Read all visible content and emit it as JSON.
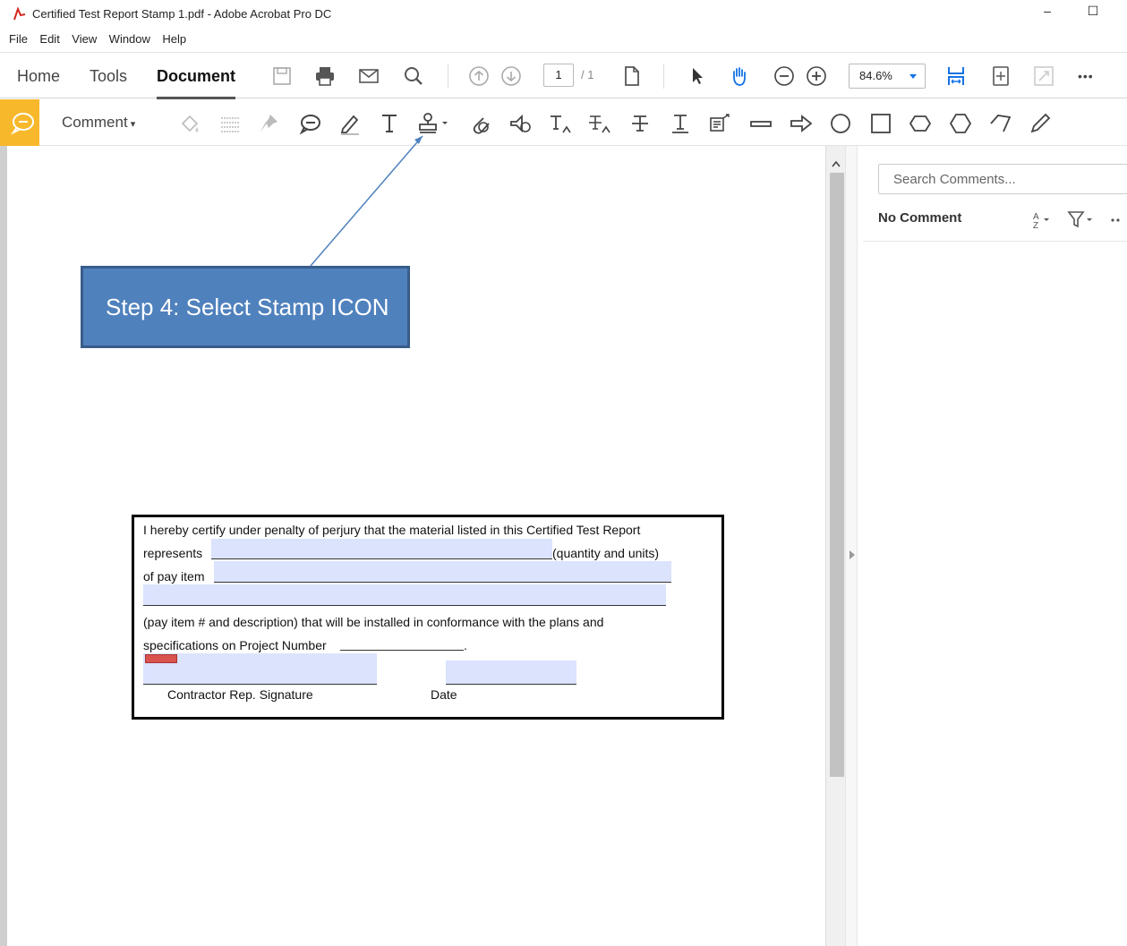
{
  "window": {
    "title": "Certified Test Report Stamp 1.pdf - Adobe Acrobat Pro DC",
    "minimize_glyph": "–",
    "maximize_glyph": "☐"
  },
  "menu": [
    "File",
    "Edit",
    "View",
    "Window",
    "Help"
  ],
  "nav_tabs": [
    "Home",
    "Tools",
    "Document"
  ],
  "page_nav": {
    "current": "1",
    "total": "/ 1"
  },
  "zoom": "84.6%",
  "more_glyph": "•••",
  "comment_toolbar": {
    "label": "Comment",
    "caret": "▾",
    "tools": [
      "comment-icon",
      "highlight-tool-icon",
      "underline-tool-icon",
      "pin-icon",
      "sticky-note-icon",
      "pencil-highlighter-icon",
      "text-t-icon",
      "stamp-icon",
      "attach-icon",
      "record-audio-icon",
      "text-insert-icon",
      "text-replace-icon",
      "strikethrough-icon",
      "underline-text-icon",
      "callout-icon",
      "line-icon",
      "arrow-icon",
      "oval-icon",
      "rectangle-icon",
      "cloud-icon",
      "polygon-icon",
      "polygon-line-icon",
      "pencil-icon"
    ]
  },
  "right_panel": {
    "search_placeholder": "Search Comments...",
    "no_comment": "No Comment"
  },
  "callout": {
    "text": "Step 4: Select Stamp ICON"
  },
  "form": {
    "line1": "I hereby certify under penalty of perjury that the material listed in this Certified Test Report",
    "line2_prefix": "represents ",
    "line2_suffix": "(quantity and units)",
    "line3_prefix": "of pay item ",
    "line5": "(pay item # and description)  that will be installed in conformance with the plans and",
    "line6_prefix": "specifications on Project Number",
    "line6_suffix": " .",
    "signature_label": "Contractor Rep. Signature",
    "date_label": "Date"
  },
  "colors": {
    "accent_blue": "#1473e6",
    "comment_yellow": "#f7b82b",
    "callout_fill": "#4f81bd",
    "field_fill": "#dbe3fd"
  }
}
